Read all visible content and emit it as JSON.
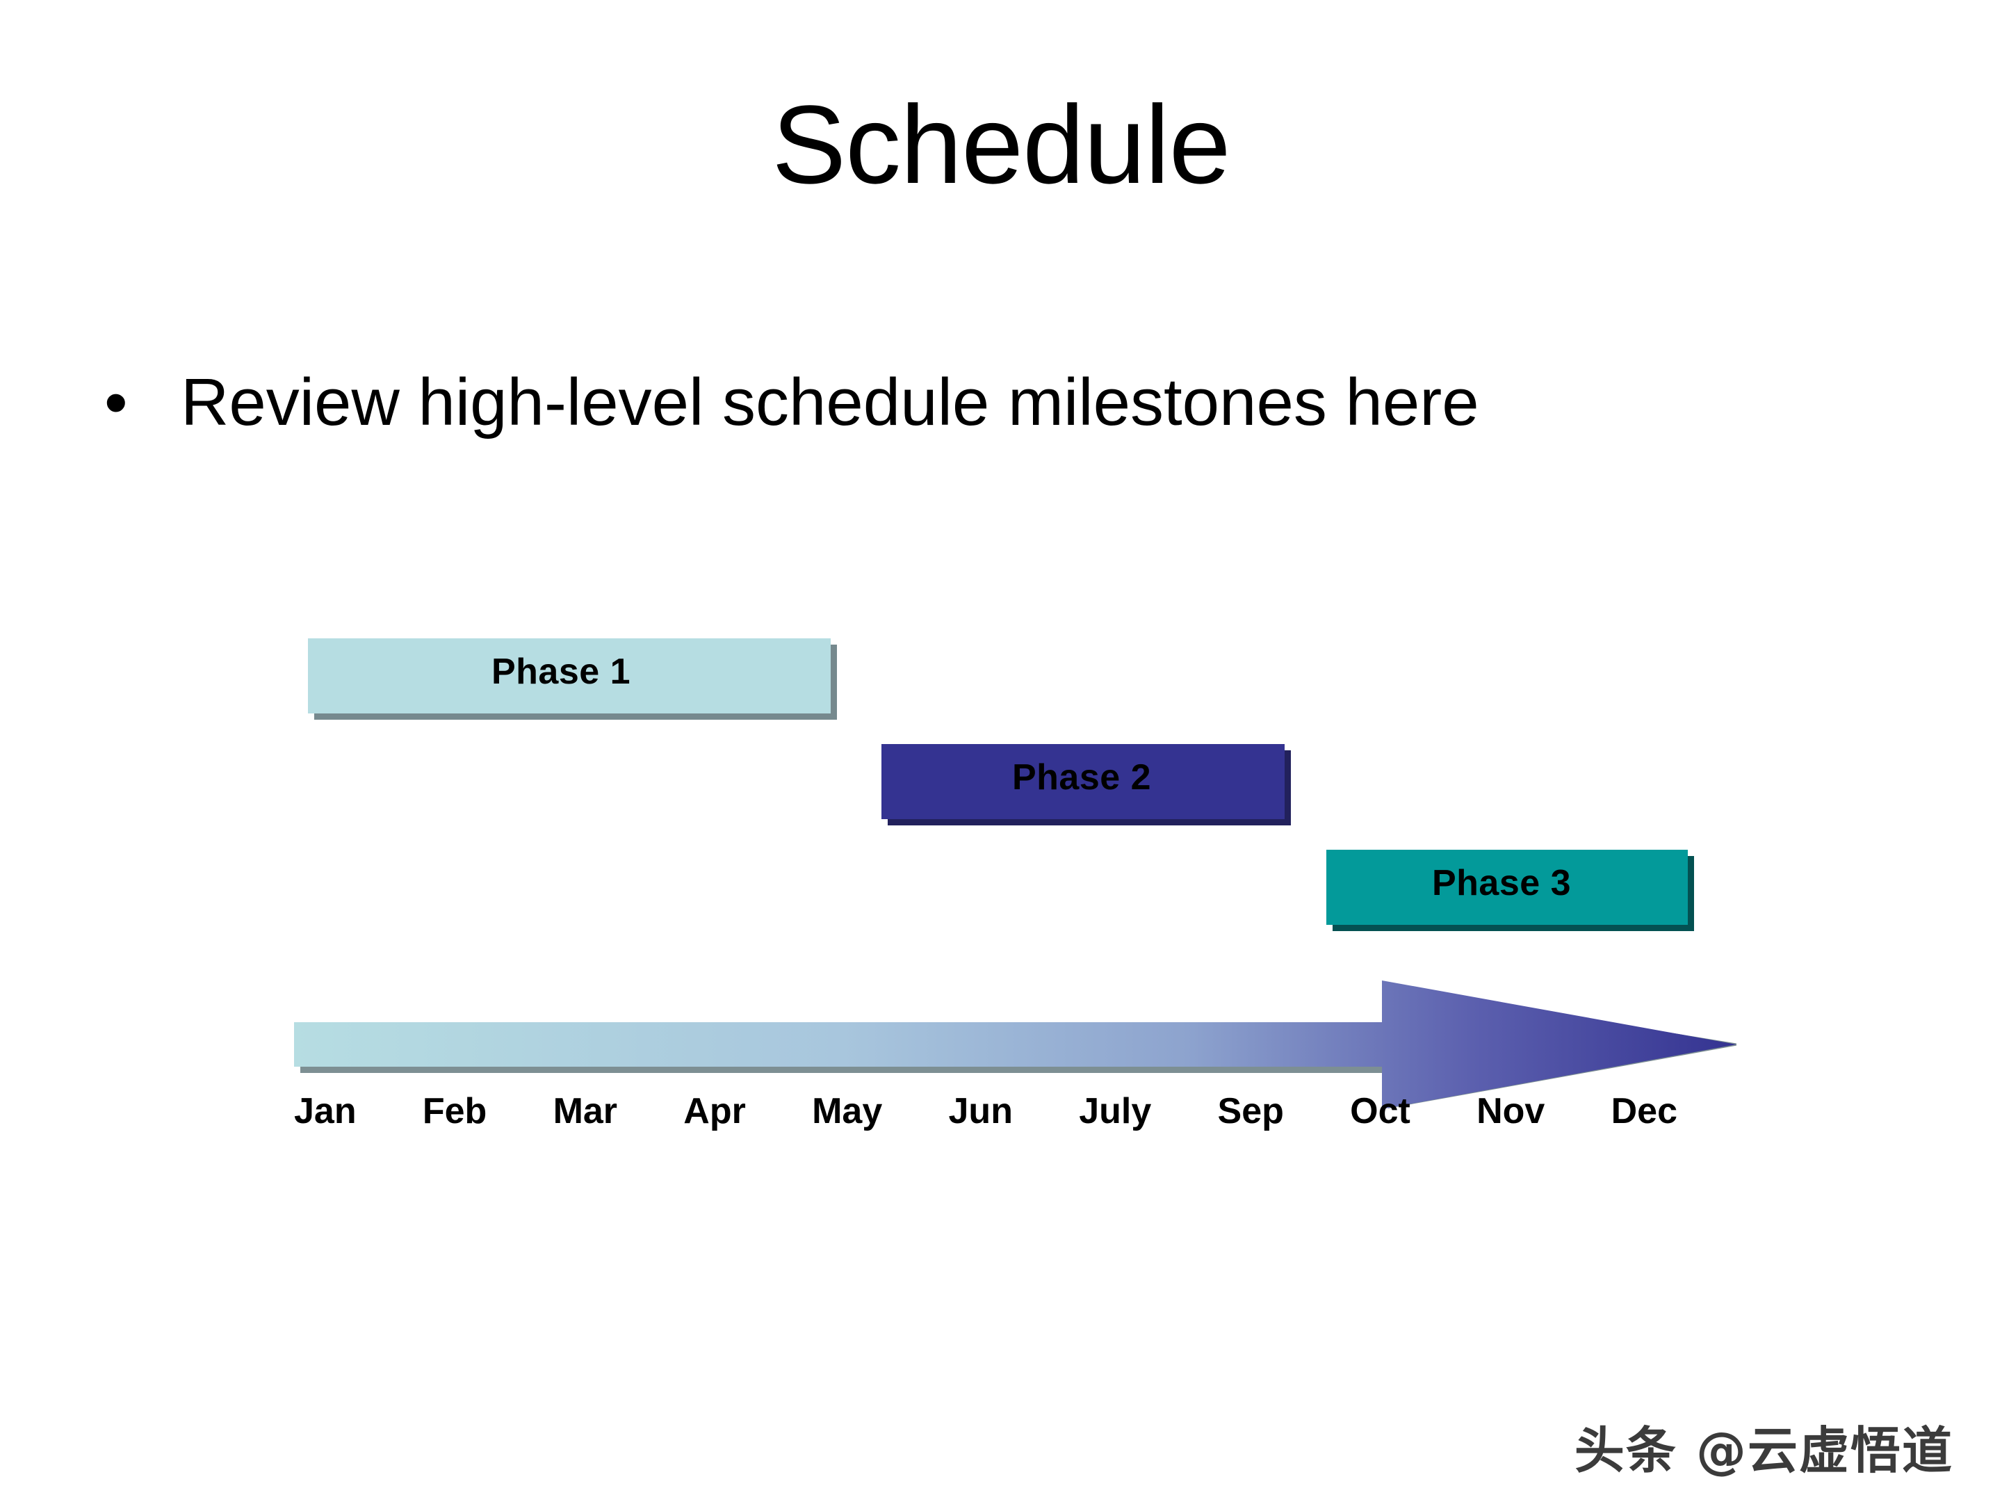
{
  "slide": {
    "title": "Schedule",
    "background_color": "#ffffff"
  },
  "body": {
    "bullets": [
      {
        "marker": "•",
        "text": "Review high-level schedule milestones here"
      }
    ]
  },
  "chart_data": {
    "type": "bar",
    "title": "Schedule",
    "xlabel": "",
    "ylabel": "",
    "grid": false,
    "legend": "none",
    "orientation": "horizontal",
    "categories": [
      "Phase 1",
      "Phase 2",
      "Phase 3"
    ],
    "x": [
      "Jan",
      "Feb",
      "Mar",
      "Apr",
      "May",
      "Jun",
      "July",
      "Sep",
      "Oct",
      "Nov",
      "Dec"
    ],
    "tick_labels": [
      "Jan",
      "Feb",
      "Mar",
      "Apr",
      "May",
      "Jun",
      "July",
      "Sep",
      "Oct",
      "Nov",
      "Dec"
    ],
    "series": [
      {
        "name": "Phase 1",
        "start": "Jan",
        "end": "Apr",
        "start_index": 0,
        "end_index": 4,
        "color": "#b6dde2",
        "shadow_color": "#76898e"
      },
      {
        "name": "Phase 2",
        "start": "May",
        "end": "July",
        "start_index": 4.6,
        "end_index": 7.8,
        "color": "#343391",
        "shadow_color": "#22215c"
      },
      {
        "name": "Phase 3",
        "start": "Oct",
        "end": "Dec",
        "start_index": 8.2,
        "end_index": 11,
        "color": "#039a9a",
        "shadow_color": "#045152"
      }
    ],
    "axis_arrow": {
      "direction": "right",
      "gradient_from": "#b6dde2",
      "gradient_to": "#343391"
    }
  },
  "timeline": {
    "months": [
      "Jan",
      "Feb",
      "Mar",
      "Apr",
      "May",
      "Jun",
      "July",
      "Sep",
      "Oct",
      "Nov",
      "Dec"
    ],
    "arrow_gradient_start": "#b6dde2",
    "arrow_gradient_end": "#343391",
    "arrow_shadow": "#7d8f93"
  },
  "phases": [
    {
      "label": "Phase 1",
      "color": "#b6dde2",
      "shadow": "#76898e"
    },
    {
      "label": "Phase 2",
      "color": "#343391",
      "shadow": "#22215c"
    },
    {
      "label": "Phase 3",
      "color": "#039a9a",
      "shadow": "#045152"
    }
  ],
  "watermark": {
    "text": "头条 @云虚悟道"
  }
}
